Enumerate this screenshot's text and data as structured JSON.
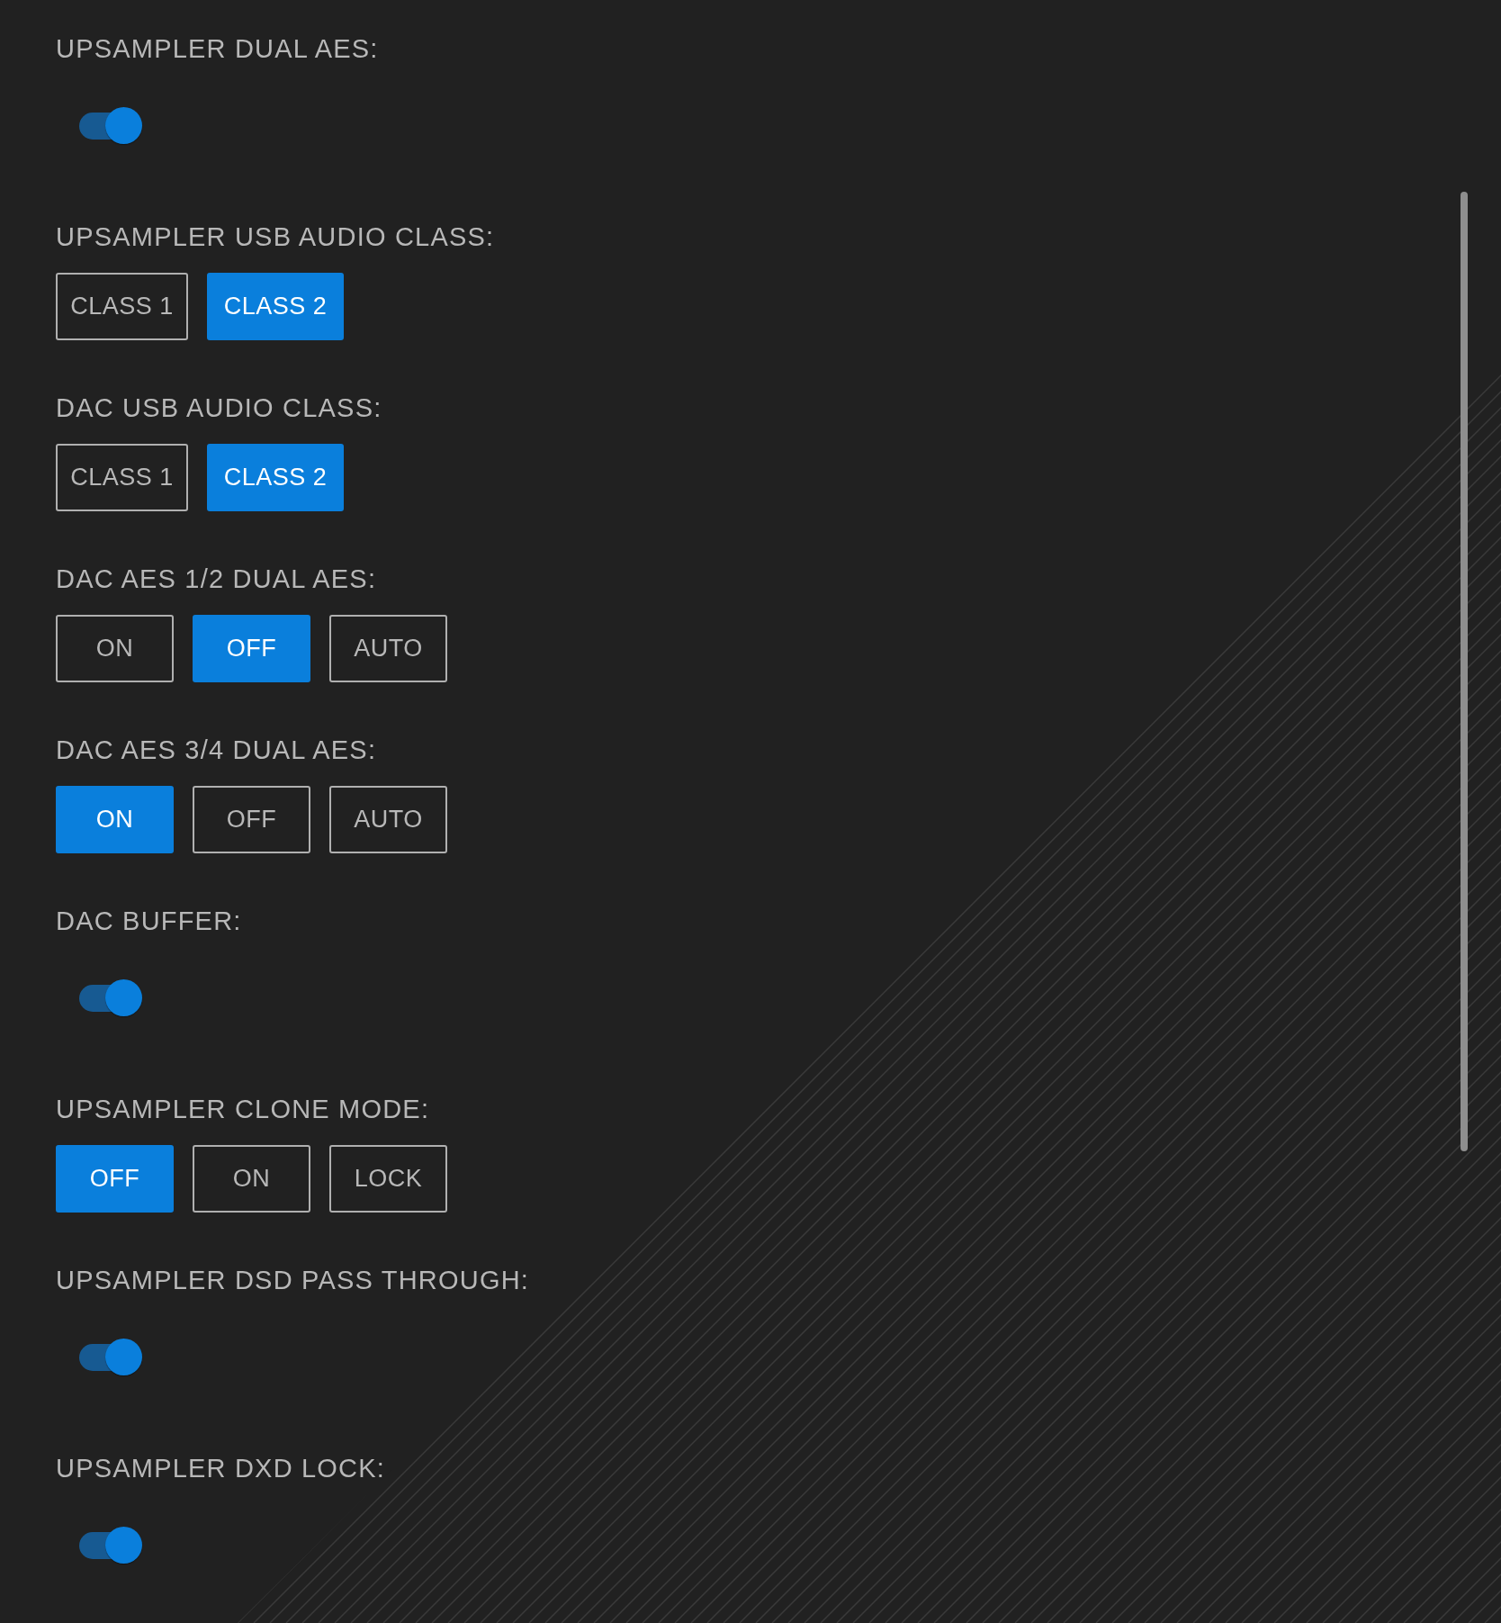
{
  "settings": [
    {
      "kind": "toggle",
      "label": "UPSAMPLER DUAL AES:",
      "on": true
    },
    {
      "kind": "buttons",
      "label": "UPSAMPLER USB AUDIO CLASS:",
      "options": [
        {
          "label": "CLASS 1",
          "selected": false
        },
        {
          "label": "CLASS 2",
          "selected": true
        }
      ]
    },
    {
      "kind": "buttons",
      "label": "DAC USB AUDIO CLASS:",
      "options": [
        {
          "label": "CLASS 1",
          "selected": false
        },
        {
          "label": "CLASS 2",
          "selected": true
        }
      ]
    },
    {
      "kind": "buttons",
      "label": "DAC AES 1/2 DUAL AES:",
      "options": [
        {
          "label": "ON",
          "selected": false
        },
        {
          "label": "OFF",
          "selected": true
        },
        {
          "label": "AUTO",
          "selected": false
        }
      ]
    },
    {
      "kind": "buttons",
      "label": "DAC AES 3/4 DUAL AES:",
      "options": [
        {
          "label": "ON",
          "selected": true
        },
        {
          "label": "OFF",
          "selected": false
        },
        {
          "label": "AUTO",
          "selected": false
        }
      ]
    },
    {
      "kind": "toggle",
      "label": "DAC BUFFER:",
      "on": true
    },
    {
      "kind": "buttons",
      "label": "UPSAMPLER CLONE MODE:",
      "options": [
        {
          "label": "OFF",
          "selected": true
        },
        {
          "label": "ON",
          "selected": false
        },
        {
          "label": "LOCK",
          "selected": false
        }
      ]
    },
    {
      "kind": "toggle",
      "label": "UPSAMPLER DSD PASS THROUGH:",
      "on": true
    },
    {
      "kind": "toggle",
      "label": "UPSAMPLER DXD LOCK:",
      "on": true
    }
  ]
}
